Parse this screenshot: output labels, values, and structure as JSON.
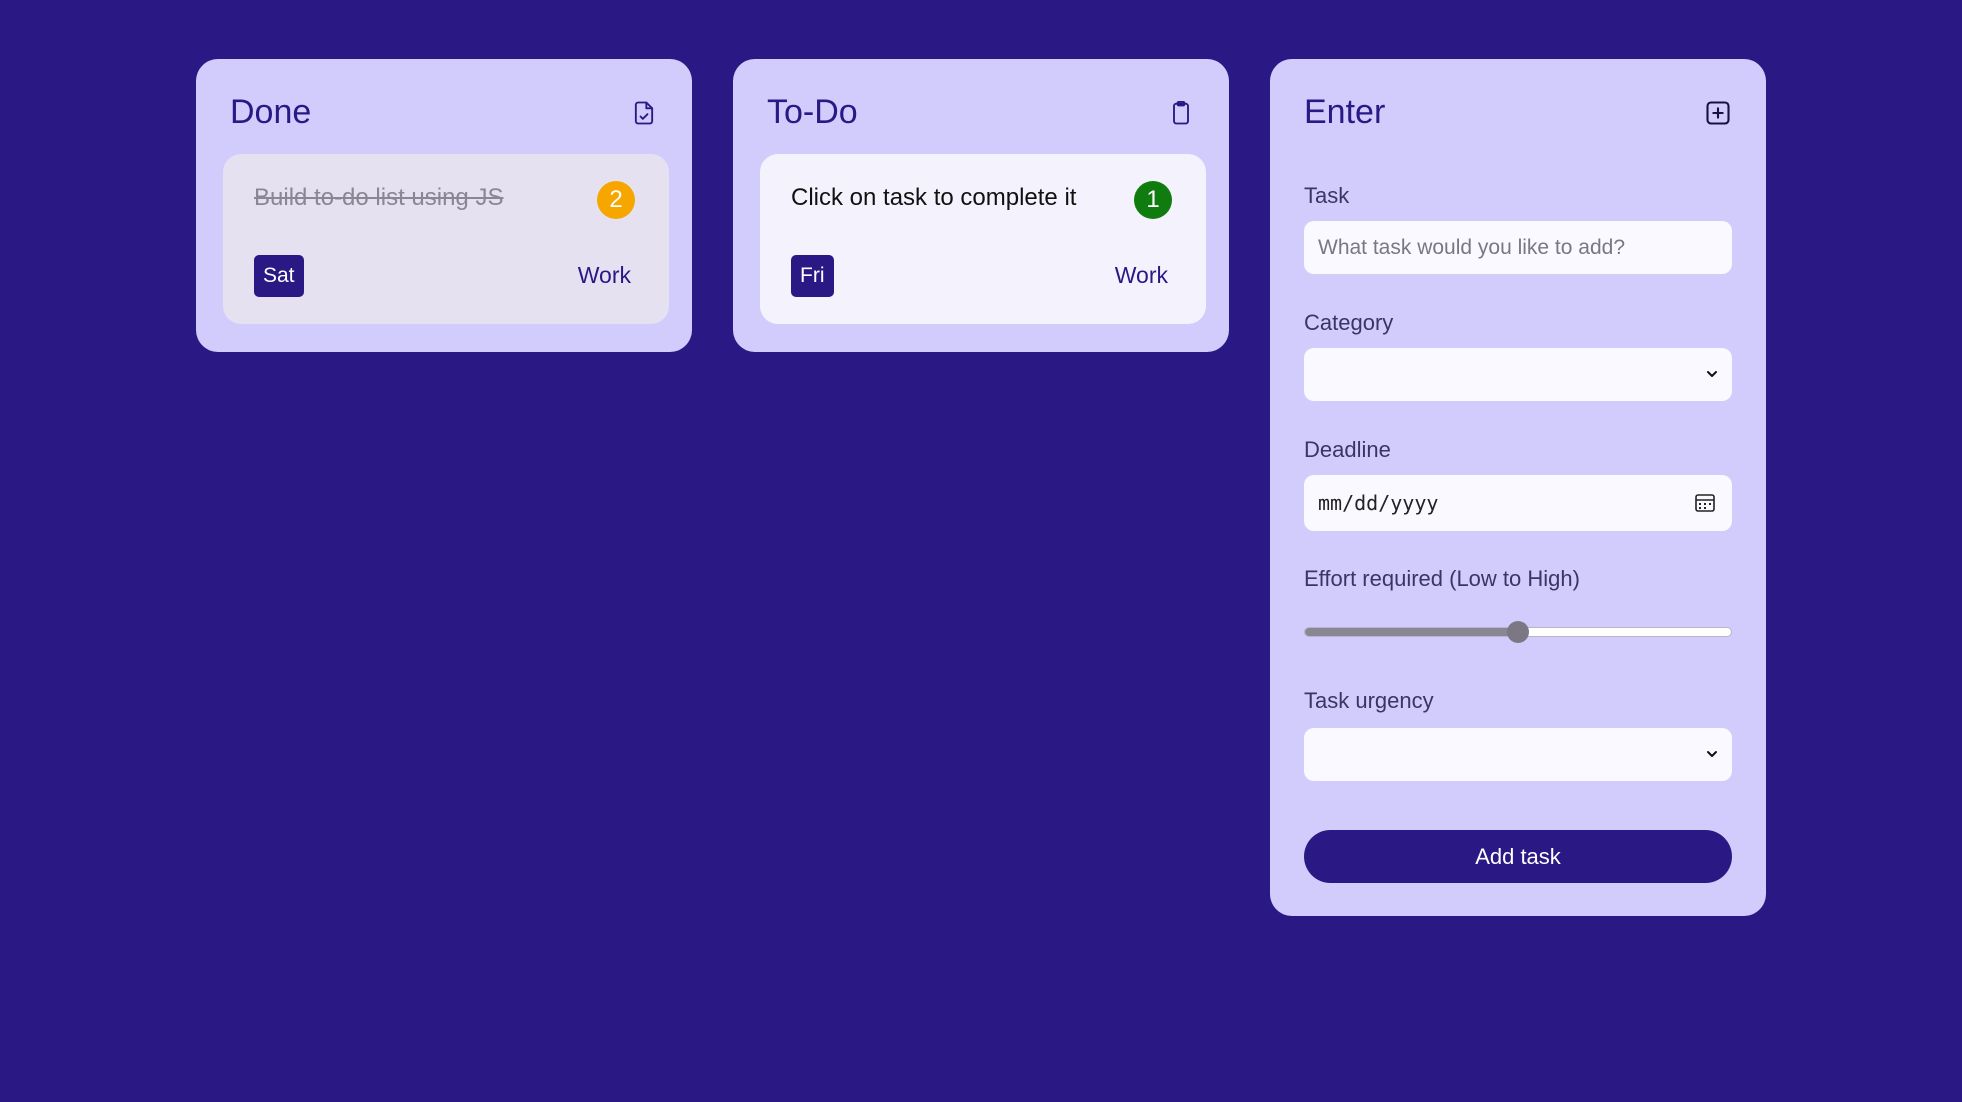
{
  "colors": {
    "background": "#2a1985",
    "panel": "#d2ccfc",
    "accent": "#2a1985",
    "priority_2": "#f7a600",
    "priority_1": "#107c10"
  },
  "done_panel": {
    "title": "Done",
    "icon": "file-check-icon",
    "task": {
      "text": "Build to-do list using JS",
      "priority": "2",
      "day": "Sat",
      "category": "Work"
    }
  },
  "todo_panel": {
    "title": "To-Do",
    "icon": "clipboard-icon",
    "task": {
      "text": "Click on task to complete it",
      "priority": "1",
      "day": "Fri",
      "category": "Work"
    }
  },
  "enter_panel": {
    "title": "Enter",
    "icon": "plus-square-icon",
    "task_label": "Task",
    "task_placeholder": "What task would you like to add?",
    "category_label": "Category",
    "category_value": "",
    "deadline_label": "Deadline",
    "deadline_placeholder": "mm/dd/yyyy",
    "effort_label": "Effort required (Low to High)",
    "effort_value_fraction": 0.5,
    "urgency_label": "Task urgency",
    "urgency_value": "",
    "add_button_label": "Add task"
  }
}
